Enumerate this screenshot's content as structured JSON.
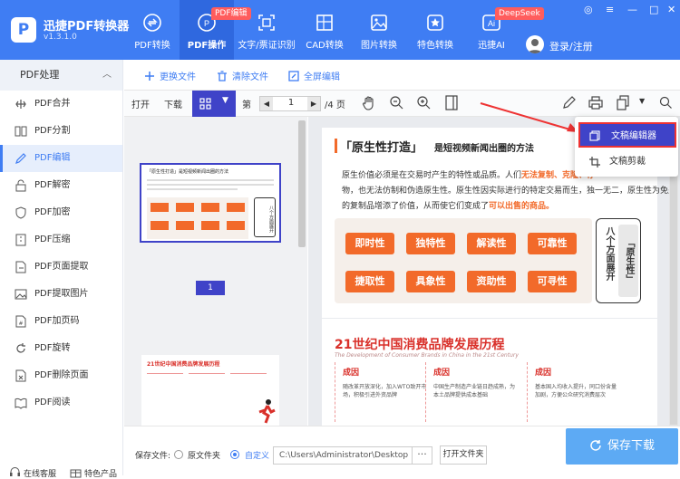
{
  "app": {
    "name": "迅捷PDF转换器",
    "version": "v1.3.1.0",
    "logo_letter": "P"
  },
  "nav": [
    {
      "label": "PDF转换",
      "icon": "pdf-convert-icon"
    },
    {
      "label": "PDF操作",
      "icon": "pdf-operate-icon",
      "badge": "PDF编辑",
      "active": true
    },
    {
      "label": "文字/票证识别",
      "icon": "ocr-icon"
    },
    {
      "label": "CAD转换",
      "icon": "cad-icon"
    },
    {
      "label": "图片转换",
      "icon": "image-convert-icon"
    },
    {
      "label": "特色转换",
      "icon": "special-convert-icon"
    },
    {
      "label": "迅捷AI",
      "icon": "ai-icon",
      "badge": "DeepSeek",
      "icon_text": "Ai"
    }
  ],
  "user": {
    "login_label": "登录/注册"
  },
  "sidebar": {
    "header": "PDF处理",
    "items": [
      {
        "label": "PDF合并"
      },
      {
        "label": "PDF分割"
      },
      {
        "label": "PDF编辑",
        "active": true
      },
      {
        "label": "PDF解密"
      },
      {
        "label": "PDF加密"
      },
      {
        "label": "PDF压缩"
      },
      {
        "label": "PDF页面提取"
      },
      {
        "label": "PDF提取图片"
      },
      {
        "label": "PDF加页码"
      },
      {
        "label": "PDF旋转"
      },
      {
        "label": "PDF删除页面"
      },
      {
        "label": "PDF阅读"
      }
    ],
    "footer": {
      "service": "在线客服",
      "featured": "特色产品"
    }
  },
  "actions": {
    "replace": "更换文件",
    "clear": "清除文件",
    "fullscreen": "全屏编辑"
  },
  "toolbar": {
    "open": "打开",
    "download": "下载",
    "page_prefix": "第",
    "page_value": "1",
    "page_total": "/4 页"
  },
  "thumbnail": {
    "page_number": "1"
  },
  "popup": {
    "item1": "文稿编辑器",
    "item2": "文稿剪裁"
  },
  "doc": {
    "title_bracket": "「原生性打造」",
    "title_rest": "是短视频新闻出圈的方法",
    "para1": "原生价值必须是在交易时产生的特性或品质。人们",
    "para1_hl": "无法复制、克隆、存",
    "para2": "物，也无法仿制和伪造原生性。原生性因实际进行的特定交易而生，独一无二，原生性为免费",
    "para3": "的复制品增添了价值，从而使它们变成了",
    "para3_hl": "可以出售的商品。",
    "keywords_row1": [
      "即时性",
      "独特性",
      "解读性",
      "可靠性"
    ],
    "keywords_row2": [
      "捷取性",
      "具象性",
      "资助性",
      "可寻性"
    ],
    "side_card": "八个方面展开",
    "side_card_quote": "「原生性」",
    "page2_title": "21世纪中国消费品牌发展历程",
    "page2_sub": "The Development of Consumer Brands in China in the 21st Century",
    "cols": [
      {
        "head": "成因",
        "l1": "随改革开放深化，加入WTO致开市",
        "l2": "场，积极引进外资品牌"
      },
      {
        "head": "成因",
        "l1": "中国生产制造产业链日趋成熟，为",
        "l2": "本土品牌提供成本基础"
      },
      {
        "head": "成因",
        "l1": "基本国入均收入提升，同口份含量",
        "l2": "加剧，方便公众研究消费层次"
      }
    ]
  },
  "mini_thumb": {
    "title": "「原生性打造」是短视频新闻出圈的方法",
    "side": "八个方面展开",
    "page2_title": "21世纪中国消费品牌发展历程"
  },
  "bottom": {
    "save_to": "保存文件:",
    "opt_original": "原文件夹",
    "opt_custom": "自定义",
    "path": "C:\\Users\\Administrator\\Desktop",
    "dots": "···",
    "open_folder": "打开文件夹",
    "save_download": "保存下载"
  },
  "colors": {
    "primary": "#3f7df3",
    "accent_orange": "#f26a2a",
    "title_red": "#d9302a",
    "dark_toolbar": "#3f43c8"
  }
}
